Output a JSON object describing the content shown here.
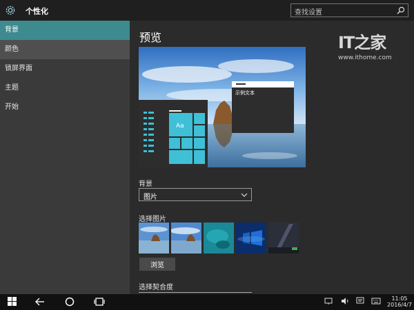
{
  "window": {
    "title": "个性化"
  },
  "search": {
    "placeholder": "查找设置"
  },
  "sidebar": {
    "items": [
      {
        "label": "背景",
        "state": "active"
      },
      {
        "label": "颜色",
        "state": "hover"
      },
      {
        "label": "锁屏界面",
        "state": "normal"
      },
      {
        "label": "主题",
        "state": "normal"
      },
      {
        "label": "开始",
        "state": "normal"
      }
    ]
  },
  "main": {
    "heading": "预览",
    "preview_sample_text": "示例文本",
    "preview_tile_label": "Aa",
    "background_label": "背景",
    "background_value": "图片",
    "choose_picture_label": "选择图片",
    "browse_label": "浏览",
    "fit_label": "选择契合度"
  },
  "watermark": {
    "logo": "IT之家",
    "url": "www.ithome.com"
  },
  "taskbar": {
    "time": "11:05",
    "date": "2016/4/7"
  },
  "colors": {
    "accent": "#3d8a8f",
    "tile": "#3fc0d6",
    "sidebar": "#3a3a3a",
    "main": "#2b2b2b",
    "titlebar": "#1f1f1f",
    "taskbar": "#111111"
  },
  "icons": [
    "gear-icon",
    "search-icon",
    "chevron-down-icon",
    "windows-icon",
    "back-icon",
    "cortana-icon",
    "task-view-icon",
    "network-icon",
    "volume-icon",
    "notifications-icon",
    "keyboard-icon"
  ]
}
